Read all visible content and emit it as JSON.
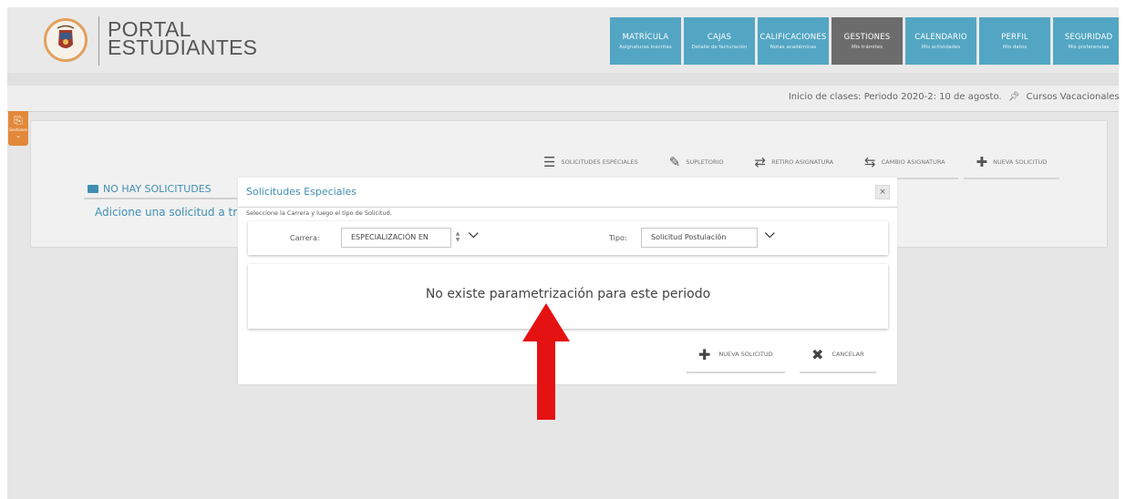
{
  "brand": {
    "line1": "PORTAL",
    "line2": "ESTUDIANTES"
  },
  "nav": [
    {
      "title": "MATRÍCULA",
      "sub": "Asignaturas inscritas"
    },
    {
      "title": "CAJAS",
      "sub": "Detalle de facturación"
    },
    {
      "title": "CALIFICACIONES",
      "sub": "Notas académicas"
    },
    {
      "title": "GESTIONES",
      "sub": "Mis trámites",
      "active": true
    },
    {
      "title": "CALENDARIO",
      "sub": "Mis actividades"
    },
    {
      "title": "PERFIL",
      "sub": "Mis datos"
    },
    {
      "title": "SEGURIDAD",
      "sub": "Mis preferencias"
    }
  ],
  "info_bar": {
    "text1": "Inicio de clases:  Periodo 2020-2: 10 de agosto.",
    "text2": "Cursos Vacacionales:"
  },
  "side_tab": {
    "label": "Gestiones"
  },
  "actions": [
    {
      "label": "SOLICITUDES ESPECIALES",
      "icon": "list-icon"
    },
    {
      "label": "SUPLETORIO",
      "icon": "edit-icon"
    },
    {
      "label": "RETIRO ASIGNATURA",
      "icon": "shuffle-icon"
    },
    {
      "label": "CAMBIO ASIGNATURA",
      "icon": "exchange-icon"
    },
    {
      "label": "NUEVA SOLICITUD",
      "icon": "plus-icon"
    }
  ],
  "panel": {
    "no_requests": "NO HAY SOLICITUDES",
    "add_hint": "Adicione una solicitud a tra"
  },
  "modal": {
    "title": "Solicitudes Especiales",
    "close": "×",
    "hint": "Seleccione la Carrera y luego el tipo de Solicitud.",
    "career_label": "Carrera:",
    "career_value": "ESPECIALIZACIÓN EN",
    "type_label": "Tipo:",
    "type_value": "Solicitud Postulación",
    "message": "No existe parametrización para este periodo",
    "new_button": "NUEVA SOLICITUD",
    "cancel_button": "CANCELAR"
  },
  "colors": {
    "nav_blue": "#53a6c3",
    "nav_active": "#6c6c6c",
    "accent_blue": "#3f8fb2",
    "side_tab_orange": "#e2883a",
    "arrow_red": "#e41212"
  }
}
